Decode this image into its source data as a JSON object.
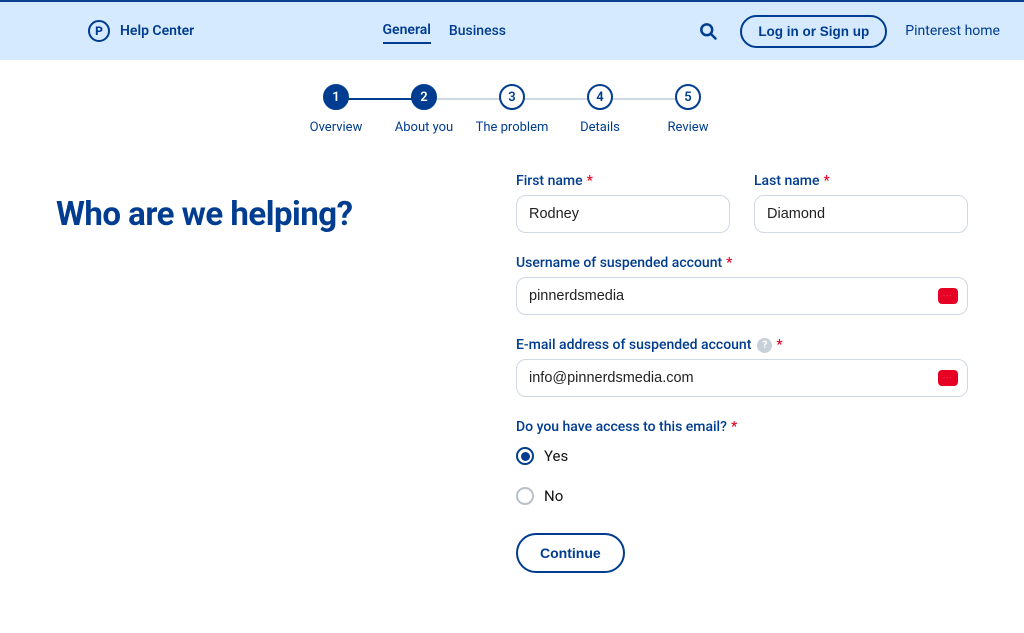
{
  "header": {
    "brand": "Help Center",
    "tabs": {
      "general": "General",
      "business": "Business"
    },
    "login": "Log in or Sign up",
    "home": "Pinterest home"
  },
  "stepper": {
    "items": [
      {
        "num": "1",
        "label": "Overview",
        "active": true
      },
      {
        "num": "2",
        "label": "About you",
        "active": true
      },
      {
        "num": "3",
        "label": "The problem",
        "active": false
      },
      {
        "num": "4",
        "label": "Details",
        "active": false
      },
      {
        "num": "5",
        "label": "Review",
        "active": false
      }
    ]
  },
  "page": {
    "title": "Who are we helping?"
  },
  "form": {
    "first_name_label": "First name",
    "first_name": "Rodney",
    "last_name_label": "Last name",
    "last_name": "Diamond",
    "username_label": "Username of suspended account",
    "username": "pinnerdsmedia",
    "email_label": "E-mail address of suspended account",
    "email": "info@pinnerdsmedia.com",
    "access_label": "Do you have access to this email?",
    "access_yes": "Yes",
    "access_no": "No",
    "access_selected": "yes",
    "continue": "Continue",
    "required_mark": "*"
  }
}
